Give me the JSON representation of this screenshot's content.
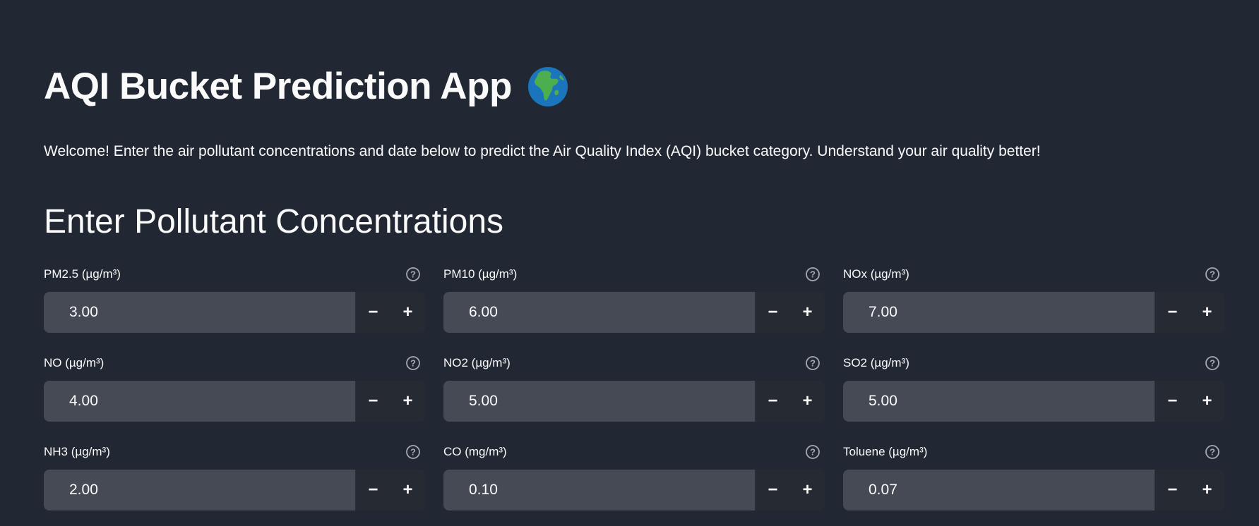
{
  "header": {
    "title": "AQI Bucket Prediction App",
    "title_icon": "globe-africa-icon",
    "welcome": "Welcome! Enter the air pollutant concentrations and date below to predict the Air Quality Index (AQI) bucket category. Understand your air quality better!"
  },
  "section": {
    "heading": "Enter Pollutant Concentrations"
  },
  "fields": [
    {
      "label": "PM2.5 (µg/m³)",
      "value": "3.00"
    },
    {
      "label": "PM10 (µg/m³)",
      "value": "6.00"
    },
    {
      "label": "NOx (µg/m³)",
      "value": "7.00"
    },
    {
      "label": "NO (µg/m³)",
      "value": "4.00"
    },
    {
      "label": "NO2 (µg/m³)",
      "value": "5.00"
    },
    {
      "label": "SO2 (µg/m³)",
      "value": "5.00"
    },
    {
      "label": "NH3 (µg/m³)",
      "value": "2.00"
    },
    {
      "label": "CO (mg/m³)",
      "value": "0.10"
    },
    {
      "label": "Toluene (µg/m³)",
      "value": "0.07"
    }
  ],
  "stepper": {
    "minus": "−",
    "plus": "+"
  },
  "colors": {
    "background": "#222833",
    "input_bg": "#454a55",
    "stepper_bg": "#262a33",
    "text": "#fafafa"
  }
}
